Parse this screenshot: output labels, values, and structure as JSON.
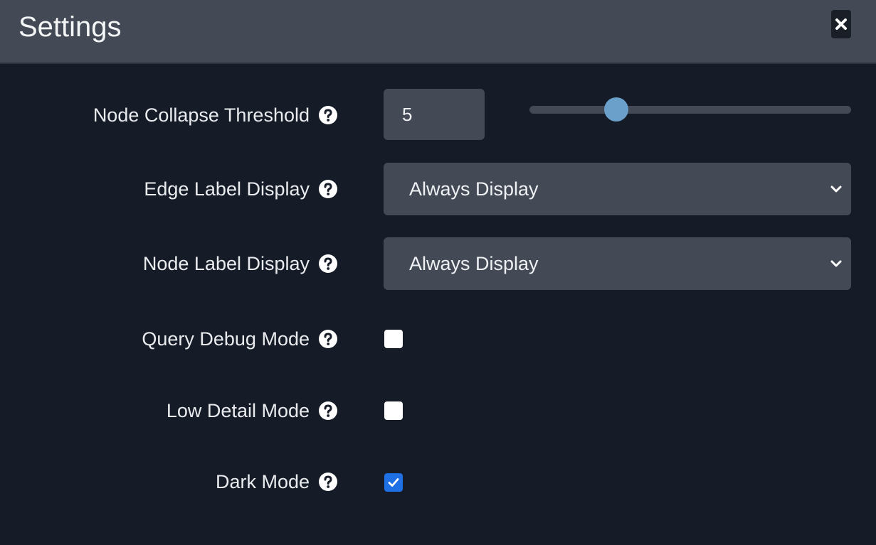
{
  "dialog": {
    "title": "Settings",
    "close_icon": "close-icon"
  },
  "settings": {
    "node_collapse_threshold": {
      "label": "Node Collapse Threshold",
      "value": "5",
      "slider_fraction": 0.27
    },
    "edge_label_display": {
      "label": "Edge Label Display",
      "selected": "Always Display"
    },
    "node_label_display": {
      "label": "Node Label Display",
      "selected": "Always Display"
    },
    "query_debug_mode": {
      "label": "Query Debug Mode",
      "checked": false
    },
    "low_detail_mode": {
      "label": "Low Detail Mode",
      "checked": false
    },
    "dark_mode": {
      "label": "Dark Mode",
      "checked": true
    }
  },
  "colors": {
    "header_bg": "#434a55",
    "body_bg": "#151c27",
    "field_bg": "#434a55",
    "slider_thumb": "#6aa0c9",
    "checkbox_checked": "#1f6fe5"
  },
  "icons": {
    "help": "question-circle-icon",
    "dropdown": "chevron-down-icon",
    "check": "check-icon"
  }
}
